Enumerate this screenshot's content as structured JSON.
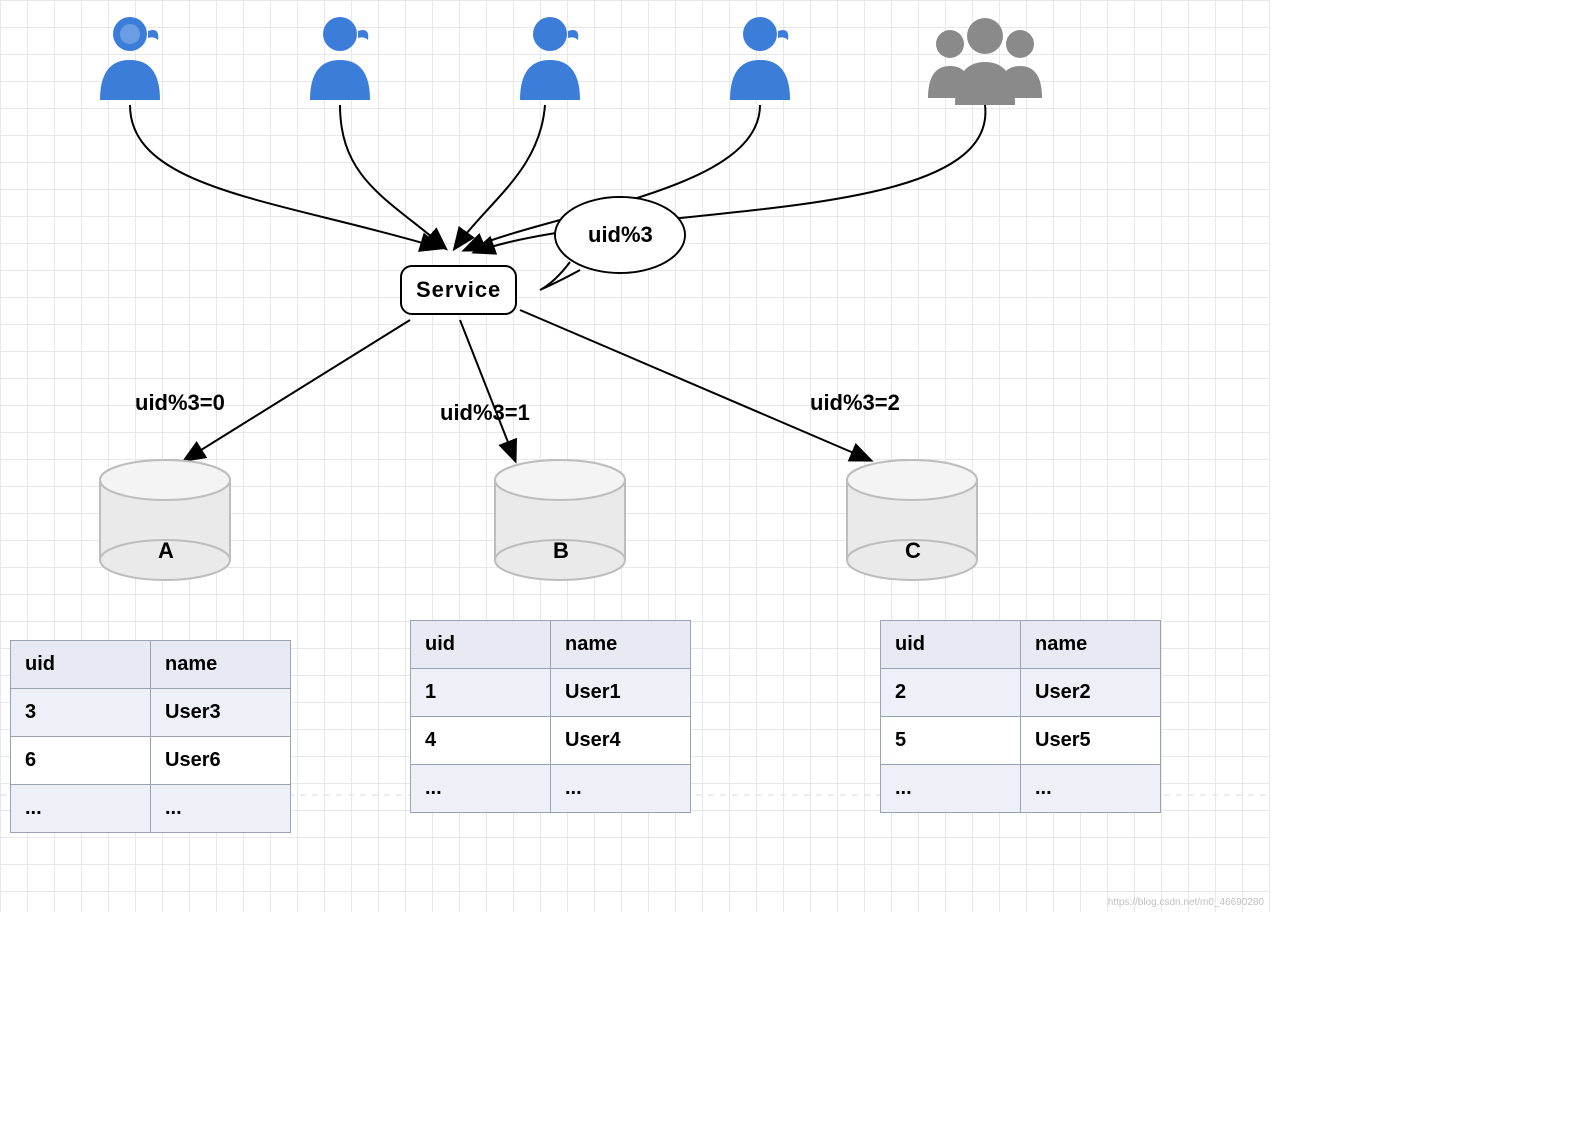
{
  "service": {
    "label": "Service"
  },
  "speech": {
    "text": "uid%3"
  },
  "edges": {
    "left": {
      "label": "uid%3=0"
    },
    "middle": {
      "label": "uid%3=1"
    },
    "right": {
      "label": "uid%3=2"
    }
  },
  "databases": {
    "a": {
      "label": "A"
    },
    "b": {
      "label": "B"
    },
    "c": {
      "label": "C"
    }
  },
  "tables": {
    "a": {
      "headers": {
        "col0": "uid",
        "col1": "name"
      },
      "rows": [
        {
          "uid": "3",
          "name": "User3"
        },
        {
          "uid": "6",
          "name": "User6"
        },
        {
          "uid": "...",
          "name": "..."
        }
      ]
    },
    "b": {
      "headers": {
        "col0": "uid",
        "col1": "name"
      },
      "rows": [
        {
          "uid": "1",
          "name": "User1"
        },
        {
          "uid": "4",
          "name": "User4"
        },
        {
          "uid": "...",
          "name": "..."
        }
      ]
    },
    "c": {
      "headers": {
        "col0": "uid",
        "col1": "name"
      },
      "rows": [
        {
          "uid": "2",
          "name": "User2"
        },
        {
          "uid": "5",
          "name": "User5"
        },
        {
          "uid": "...",
          "name": "..."
        }
      ]
    }
  },
  "colors": {
    "user_blue": "#3b7dd8",
    "group_gray": "#8a8a8a",
    "db_fill": "#eaeaea",
    "db_stroke": "#bdbdbd",
    "grid": "#e8e8ec",
    "table_header": "#e7eaf3"
  },
  "watermark": "https://blog.csdn.net/m0_46690280"
}
